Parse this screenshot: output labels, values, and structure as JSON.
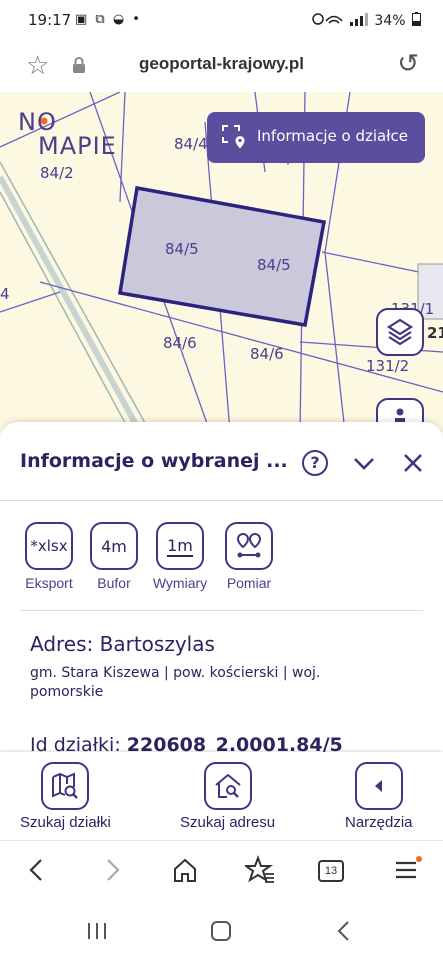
{
  "status_bar": {
    "time": "19:17",
    "icons": "▣ ⧉ ◒ •",
    "right": "34%"
  },
  "browser": {
    "url": "geoportal-krajowy.pl",
    "icons": {
      "bookmark": "star-icon",
      "secure": "lock-icon",
      "reload": "reload-icon"
    }
  },
  "map": {
    "logo_line1": "NO",
    "logo_line2": "MAPIE",
    "info_button_label": "Informacje o działce",
    "parcel_labels": [
      "84/2",
      "84/4",
      "84/4",
      "84/5",
      "84/5",
      "84/6",
      "84/6",
      "131/1",
      "131/2",
      "21",
      "4"
    ],
    "colors": {
      "selected_fill": "#cbc8dc",
      "selected_stroke": "#2a2480",
      "parcel_line": "#6b62c4",
      "background": "#fdf8e2"
    }
  },
  "panel": {
    "title": "Informacje o wybranej ...",
    "help_label": "?",
    "tools": [
      {
        "icon_text": "*xlsx",
        "label": "Eksport"
      },
      {
        "icon_text": "4m",
        "label": "Bufor"
      },
      {
        "icon_text": "1m",
        "label": "Wymiary"
      },
      {
        "icon_text": "",
        "label": "Pomiar"
      }
    ],
    "address": "Adres: Bartoszylas",
    "address_sub": "gm. Stara Kiszewa | pow. kościerski | woj. pomorskie",
    "id_label": "Id działki:",
    "id_value": "220608_2.0001.84/5"
  },
  "bottom_nav": [
    {
      "label": "Szukaj działki"
    },
    {
      "label": "Szukaj adresu"
    },
    {
      "label": "Narzędzia"
    }
  ],
  "browser_toolbar": {
    "tabs_count": "13",
    "badge_color": "#f06a2a"
  }
}
